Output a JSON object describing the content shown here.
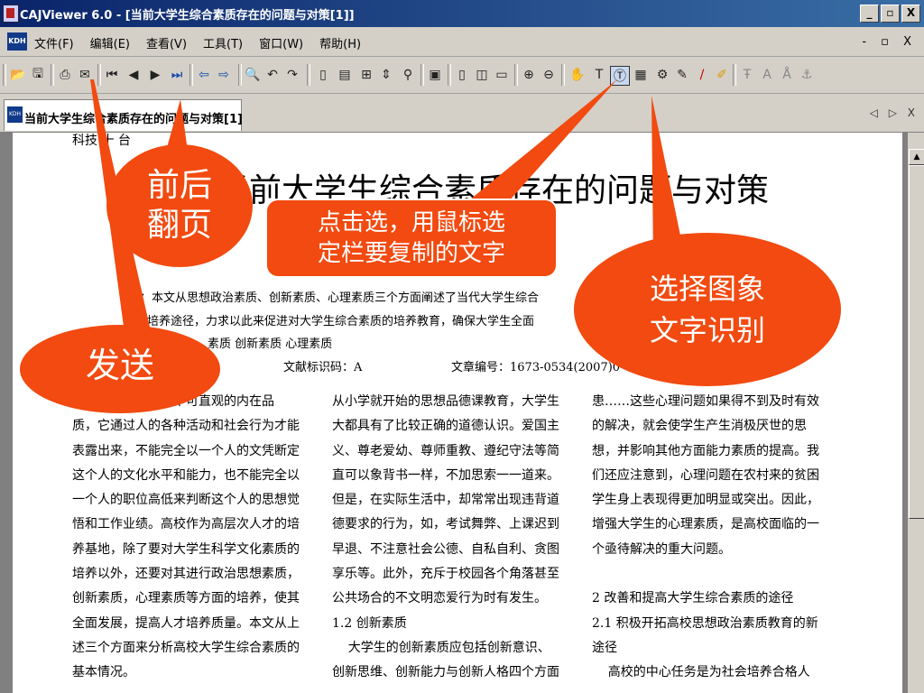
{
  "app": {
    "title": "CAJViewer 6.0 - [当前大学生综合素质存在的问题与对策[1]]",
    "window_controls": [
      "_",
      "▫",
      "X"
    ]
  },
  "menubar": {
    "items": [
      "文件(F)",
      "编辑(E)",
      "查看(V)",
      "工具(T)",
      "窗口(W)",
      "帮助(H)"
    ],
    "doc_controls": "- ▫ X",
    "logo": "KDH"
  },
  "toolbar": {
    "icons": [
      "open-icon",
      "save-icon",
      "print-icon",
      "send-icon",
      "first-page-icon",
      "prev-page-icon",
      "next-page-icon",
      "last-page-icon",
      "back-icon",
      "forward-icon",
      "find-icon",
      "undo-icon",
      "redo-icon",
      "single-page-icon",
      "continuous-page-icon",
      "facing-page-icon",
      "fit-icon",
      "link-icon",
      "thumbnail-icon",
      "page-icon",
      "two-page-icon",
      "book-icon",
      "zoom-in-icon",
      "zoom-out-icon",
      "hand-icon",
      "text-select-icon",
      "select-text-icon",
      "ocr-icon",
      "snapshot-icon",
      "note-icon",
      "pen-icon",
      "highlighter-icon",
      "strikethrough-icon",
      "underline-text-icon",
      "text-a-icon",
      "anchor-icon"
    ]
  },
  "tab": {
    "label": "当前大学生综合素质存在的问题与对策[1]",
    "controls": "◁ ▷ X"
  },
  "document": {
    "title": "当前大学生综合素质存在的问题与对策",
    "header_fragment": "科技 十 台",
    "abstract_line1": "要：本文从思想政治素质、创新素质、心理素质三个方面阐述了当代大学生综合",
    "abstract_line2": "其培养途径，力求以此来促进对大学生综合素质的培养教育，确保大学生全面",
    "keywords_line": "素质    创新素质    心理素质",
    "doc_code": "文献标识码：A",
    "article_no": "文章编号：1673-0534(2007)0",
    "col1": [
      "素质是一种潜在的不可直观的内在品",
      "质，它通过人的各种活动和社会行为才能",
      "表露出来，不能完全以一个人的文凭断定",
      "这个人的文化水平和能力，也不能完全以",
      "一个人的职位高低来判断这个人的思想觉",
      "悟和工作业绩。高校作为高层次人才的培",
      "养基地，除了要对大学生科学文化素质的",
      "培养以外，还要对其进行政治思想素质，",
      "创新素质，心理素质等方面的培养，使其",
      "全面发展，提高人才培养质量。本文从上",
      "述三个方面来分析高校大学生综合素质的",
      "基本情况。"
    ],
    "col2": [
      "从小学就开始的思想品德课教育，大学生",
      "大都具有了比较正确的道德认识。爱国主",
      "义、尊老爱幼、尊师重教、遵纪守法等简",
      "直可以象背书一样，不加思索一一道来。",
      "但是，在实际生活中，却常常出现违背道",
      "德要求的行为，如，考试舞弊、上课迟到",
      "早退、不注意社会公德、自私自利、贪图",
      "享乐等。此外，充斥于校园各个角落甚至",
      "公共场合的不文明恋爱行为时有发生。",
      "1.2 创新素质",
      "    大学生的创新素质应包括创新意识、",
      "创新思维、创新能力与创新人格四个方面"
    ],
    "col3": [
      "患……这些心理问题如果得不到及时有效",
      "的解决，就会使学生产生消极厌世的思",
      "想，并影响其他方面能力素质的提高。我",
      "们还应注意到，心理问题在农村来的贫困",
      "学生身上表现得更加明显或突出。因此，",
      "增强大学生的心理素质，是高校面临的一",
      "个亟待解决的重大问题。",
      "",
      "",
      "2 改善和提高大学生综合素质的途径",
      "2.1  积极开拓高校思想政治素质教育的新",
      "途径",
      "    高校的中心任务是为社会培养合格人"
    ]
  },
  "callouts": {
    "page_turn": "前后\n翻页",
    "select_text": "点击选，用鼠标选\n定栏要复制的文字",
    "ocr": "选择图象\n文字识别",
    "send": "发送"
  },
  "colors": {
    "callout": "#f24a10",
    "title_bar": "#0a246a"
  }
}
